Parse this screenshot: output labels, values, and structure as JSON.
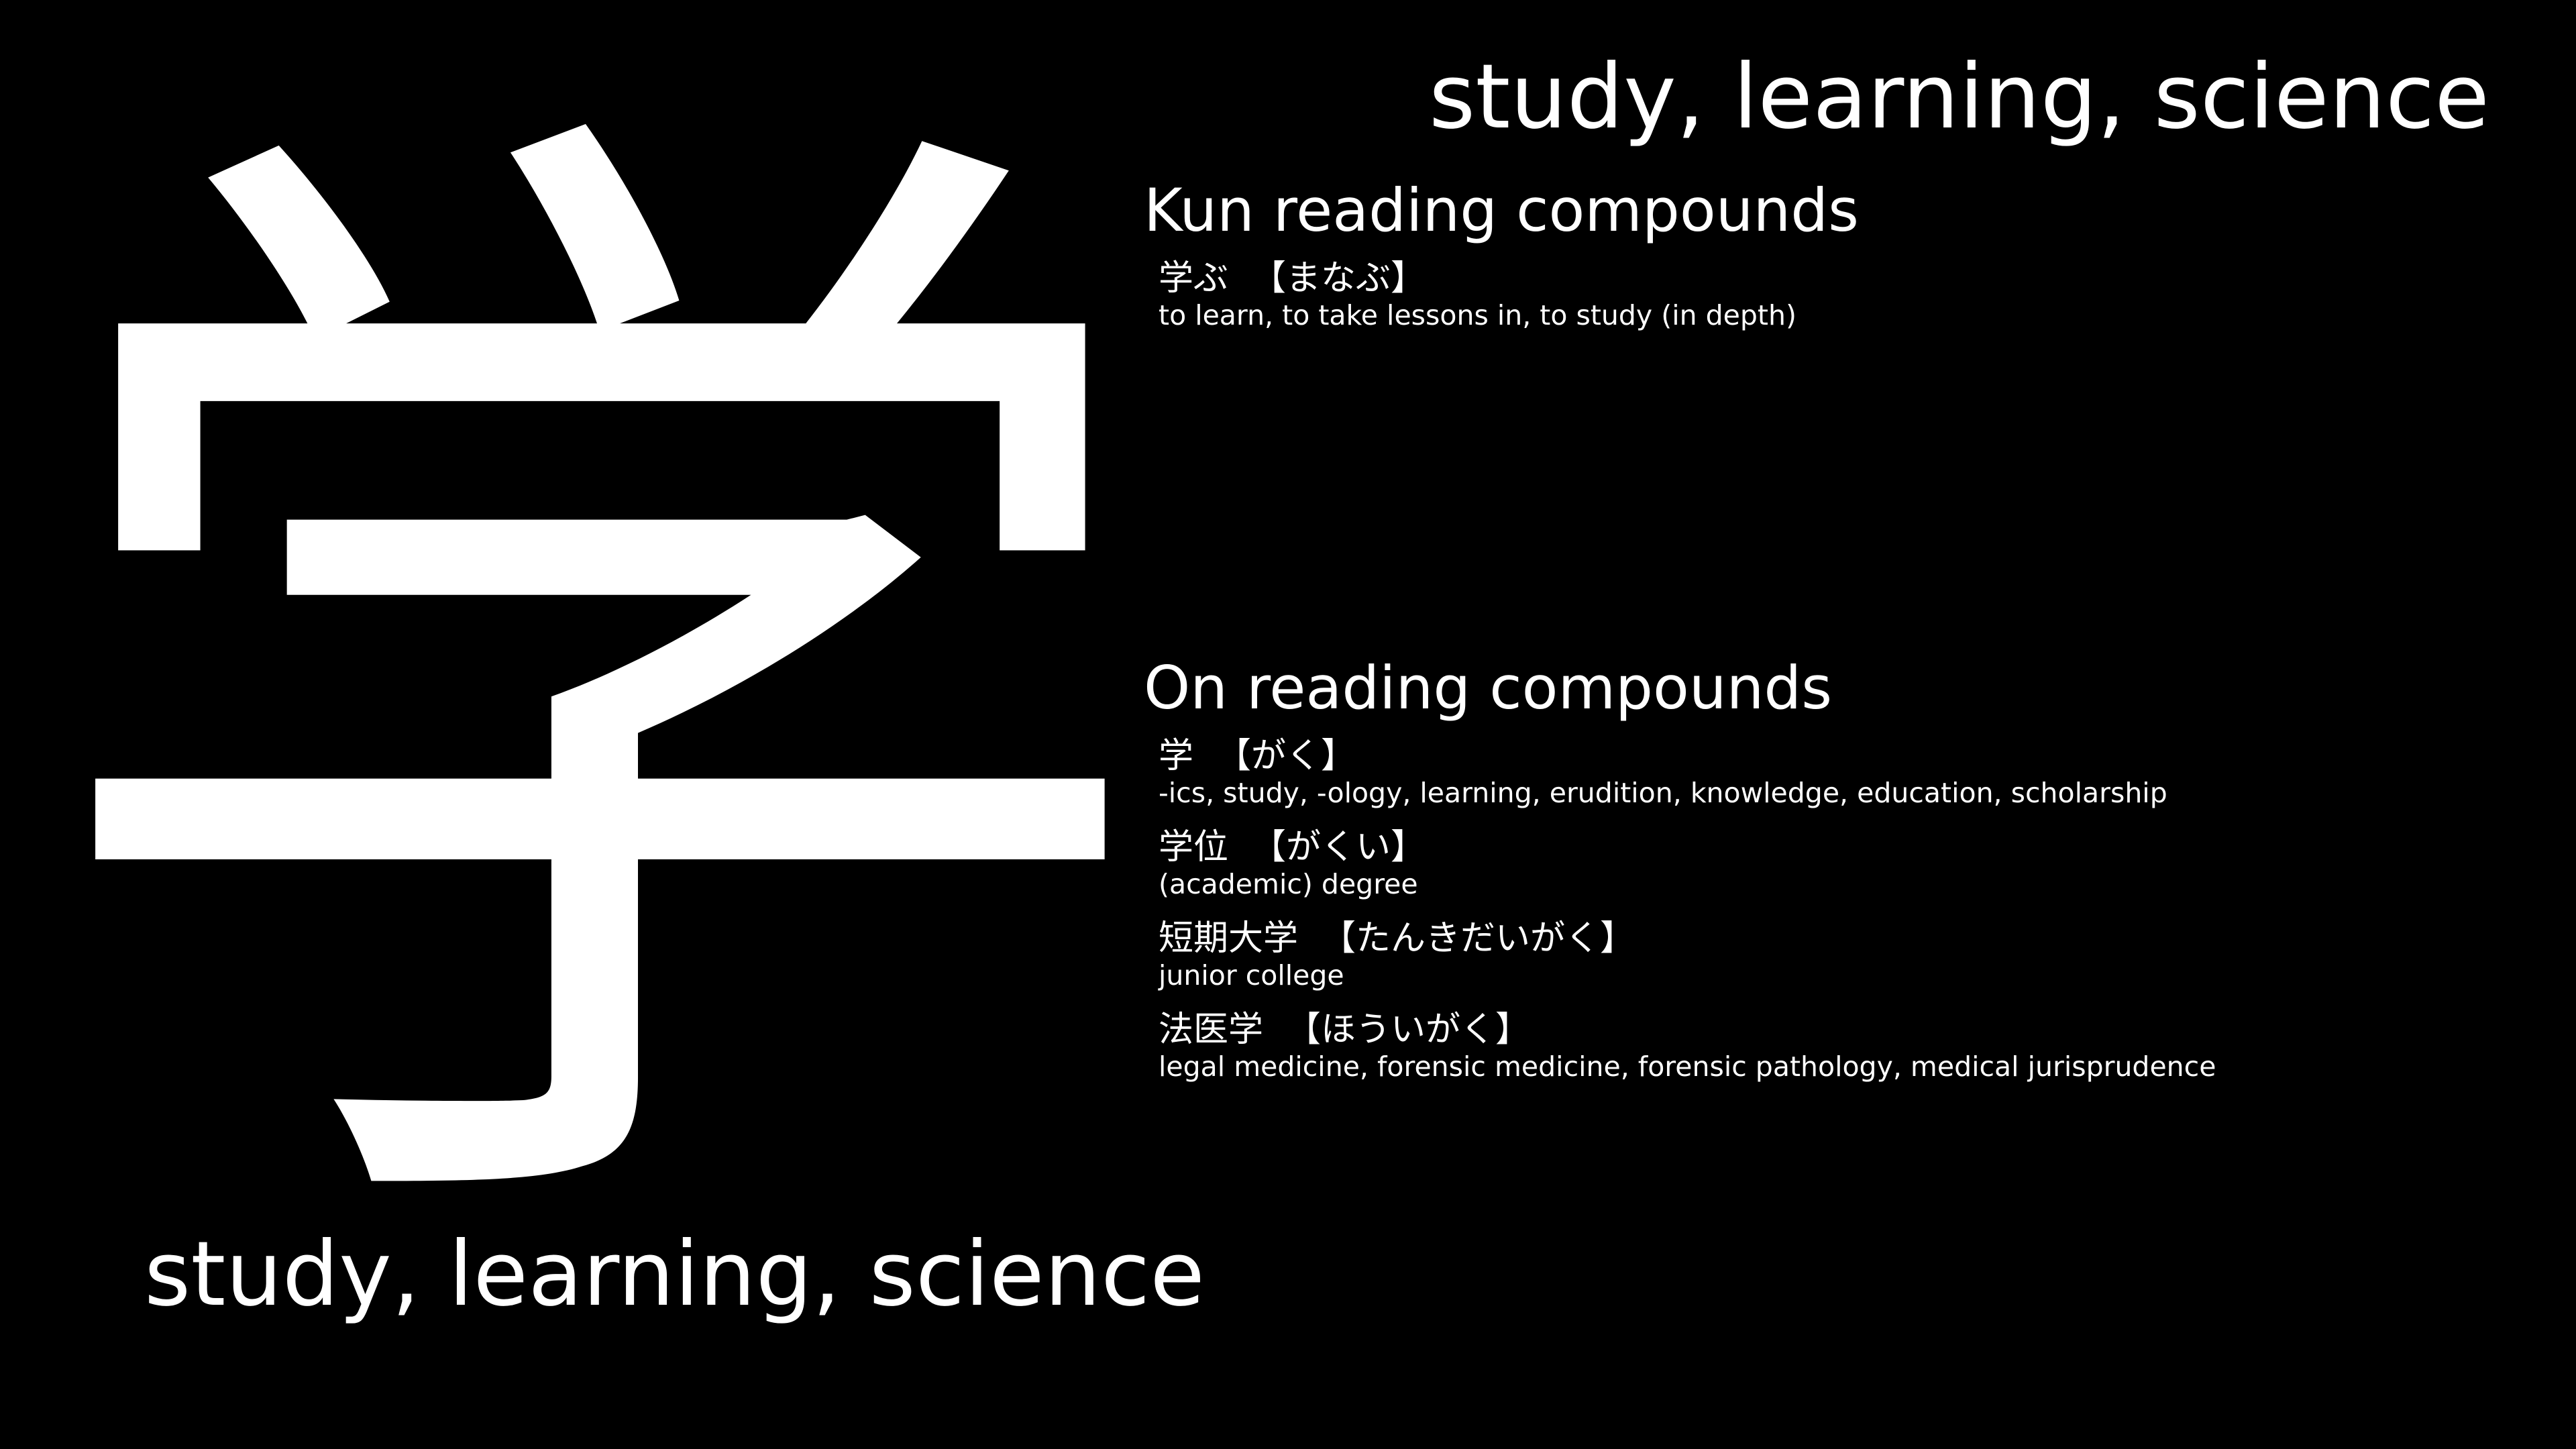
{
  "kanji": "学",
  "meaning": "study, learning, science",
  "kun_section": {
    "heading": "Kun reading compounds",
    "entries": [
      {
        "word": "学ぶ",
        "reading": "【まなぶ】",
        "gloss": "to learn, to take lessons in, to study (in depth)"
      }
    ]
  },
  "on_section": {
    "heading": "On reading compounds",
    "entries": [
      {
        "word": "学",
        "reading": "【がく】",
        "gloss": "-ics, study, -ology, learning, erudition, knowledge, education, scholarship"
      },
      {
        "word": "学位",
        "reading": "【がくい】",
        "gloss": "(academic) degree"
      },
      {
        "word": "短期大学",
        "reading": "【たんきだいがく】",
        "gloss": "junior college"
      },
      {
        "word": "法医学",
        "reading": "【ほういがく】",
        "gloss": "legal medicine, forensic medicine, forensic pathology, medical jurisprudence"
      }
    ]
  },
  "colors": {
    "background": "#000000",
    "text": "#ffffff"
  }
}
